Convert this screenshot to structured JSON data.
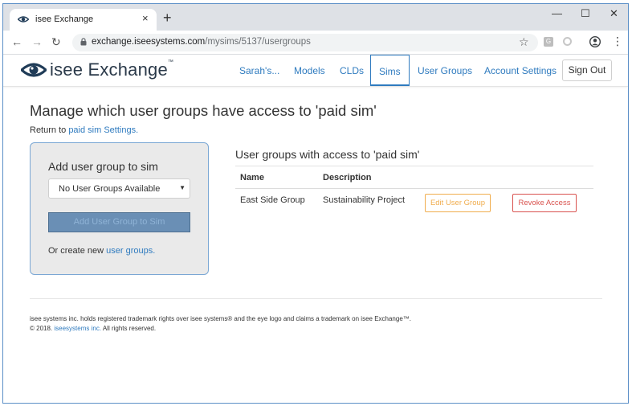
{
  "browser": {
    "tab_title": "isee Exchange",
    "tab_close": "×",
    "new_tab": "+",
    "window_controls": {
      "minimize": "—",
      "maximize": "☐",
      "close": "✕"
    },
    "nav": {
      "back": "←",
      "forward": "→",
      "reload": "↻"
    },
    "url_host": "exchange.iseesystems.com",
    "url_path": "/mysims/5137/usergroups",
    "bookmark_star": "☆",
    "extension_g": "G",
    "menu": "⋮"
  },
  "site": {
    "brand": "isee Exchange",
    "brand_mark": "™",
    "nav": [
      {
        "label": "Sarah's..."
      },
      {
        "label": "Models"
      },
      {
        "label": "CLDs"
      },
      {
        "label": "Sims",
        "active": true
      },
      {
        "label": "User Groups"
      },
      {
        "label": "Account Settings"
      }
    ],
    "sign_out": "Sign Out"
  },
  "main": {
    "title": "Manage which user groups have access to 'paid sim'",
    "return_prefix": "Return to",
    "return_link": "paid sim Settings."
  },
  "add_panel": {
    "title": "Add user group to sim",
    "select_value": "No User Groups Available",
    "add_button": "Add User Group to Sim",
    "create_prefix": "Or create new",
    "create_link": "user groups."
  },
  "groups_table": {
    "title": "User groups with access to 'paid sim'",
    "headers": [
      "Name",
      "Description"
    ],
    "rows": [
      {
        "name": "East Side Group",
        "description": "Sustainability Project",
        "edit_label": "Edit User Group",
        "revoke_label": "Revoke Access"
      }
    ]
  },
  "footer": {
    "line1": "isee systems inc. holds registered trademark rights over isee systems® and the eye logo and claims a trademark on isee Exchange™.",
    "line2_prefix": "© 2018.",
    "line2_link": "iseesystems inc.",
    "line2_suffix": "All rights reserved."
  },
  "colors": {
    "link": "#2f7bbf",
    "edit": "#f0ad4e",
    "revoke": "#d9534f",
    "panel_border": "#7aa7d4",
    "panel_bg": "#eaeaea",
    "add_button_bg": "#6a8fb5"
  }
}
